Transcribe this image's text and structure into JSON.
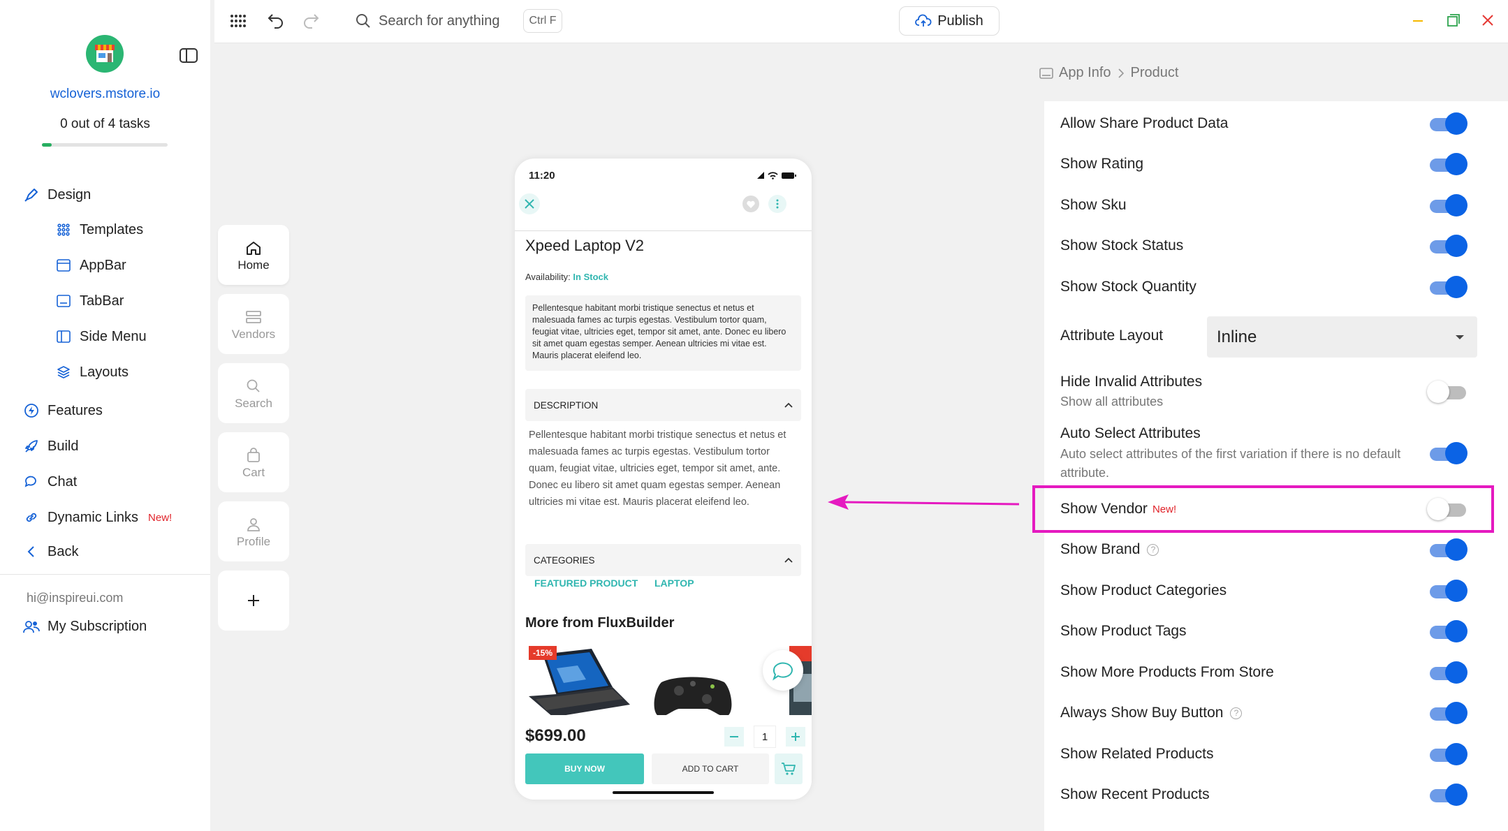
{
  "sidebar": {
    "store_name": "wclovers.mstore.io",
    "tasks": "0 out of 4 tasks",
    "task_progress": 0.08,
    "design": "Design",
    "templates": "Templates",
    "appbar": "AppBar",
    "tabbar": "TabBar",
    "side_menu": "Side Menu",
    "layouts": "Layouts",
    "features": "Features",
    "build": "Build",
    "chat": "Chat",
    "dynamic_links": "Dynamic Links",
    "new_tag": "New!",
    "back": "Back",
    "email": "hi@inspireui.com",
    "subscription": "My Subscription"
  },
  "topbar": {
    "search_placeholder": "Search for anything",
    "shortcut": "Ctrl F",
    "publish": "Publish"
  },
  "tabs": [
    {
      "label": "Home",
      "icon": "home-icon"
    },
    {
      "label": "Vendors",
      "icon": "vendors-icon"
    },
    {
      "label": "Search",
      "icon": "search-icon"
    },
    {
      "label": "Cart",
      "icon": "cart-icon"
    },
    {
      "label": "Profile",
      "icon": "profile-icon"
    }
  ],
  "phone": {
    "time": "11:20",
    "title": "Xpeed Laptop V2",
    "availability_label": "Availability:",
    "availability_value": "In Stock",
    "short_description": "Pellentesque habitant morbi tristique senectus et netus et malesuada fames ac turpis egestas. Vestibulum tortor quam, feugiat vitae, ultricies eget, tempor sit amet, ante. Donec eu libero sit amet quam egestas semper. Aenean ultricies mi vitae est. Mauris placerat eleifend leo.",
    "description_header": "DESCRIPTION",
    "description": "Pellentesque habitant morbi tristique senectus et netus et malesuada fames ac turpis egestas. Vestibulum tortor quam, feugiat vitae, ultricies eget, tempor sit amet, ante. Donec eu libero sit amet quam egestas semper. Aenean ultricies mi vitae est. Mauris placerat eleifend leo.",
    "categories_header": "CATEGORIES",
    "category_1": "FEATURED PRODUCT",
    "category_2": "LAPTOP",
    "more_from": "More from FluxBuilder",
    "discount": "-15%",
    "price": "$699.00",
    "quantity": "1",
    "buy_now": "BUY NOW",
    "add_to_cart": "ADD TO CART"
  },
  "panel": {
    "breadcrumb_root": "App Info",
    "breadcrumb_current": "Product",
    "attribute_layout_label": "Attribute Layout",
    "attribute_layout_value": "Inline",
    "hide_invalid_sub": "Show all attributes",
    "auto_select_sub": "Auto select attributes of the first variation if there is no default attribute.",
    "new_tag": "New!",
    "settings": [
      {
        "label": "Allow Share Product Data",
        "on": true
      },
      {
        "label": "Show Rating",
        "on": true
      },
      {
        "label": "Show Sku",
        "on": true
      },
      {
        "label": "Show Stock Status",
        "on": true
      },
      {
        "label": "Show Stock Quantity",
        "on": true
      },
      {
        "label": "Hide Invalid Attributes",
        "on": false
      },
      {
        "label": "Auto Select Attributes",
        "on": true
      },
      {
        "label": "Show Vendor",
        "on": false
      },
      {
        "label": "Show Brand",
        "on": true
      },
      {
        "label": "Show Product Categories",
        "on": true
      },
      {
        "label": "Show Product Tags",
        "on": true
      },
      {
        "label": "Show More Products From Store",
        "on": true
      },
      {
        "label": "Always Show Buy Button",
        "on": true
      },
      {
        "label": "Show Related Products",
        "on": true
      },
      {
        "label": "Show Recent Products",
        "on": true
      }
    ]
  },
  "colors": {
    "accent": "#0b63e5",
    "teal": "#43c6bb",
    "highlight": "#e51ac0",
    "new_tag": "#e0232a"
  }
}
